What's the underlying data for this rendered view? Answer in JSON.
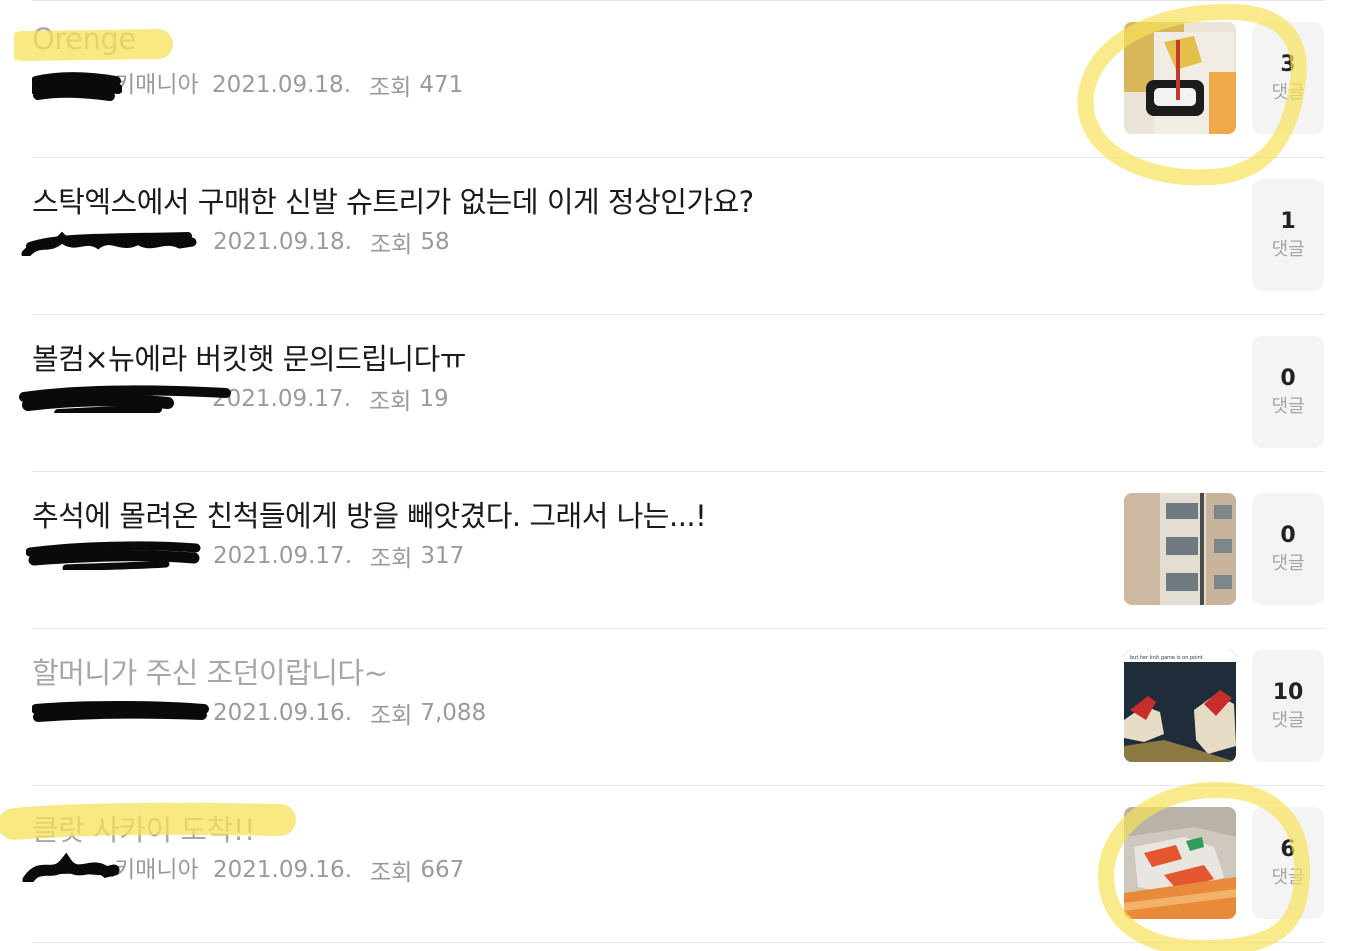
{
  "comment_label": "댓글",
  "views_label": "조회",
  "posts": [
    {
      "title": "Orenge",
      "author": "키매니아",
      "date": "2021.09.18.",
      "views": "471",
      "comments": "3",
      "read": true
    },
    {
      "title": "스탁엑스에서 구매한 신발 슈트리가 없는데 이게 정상인가요?",
      "author": "",
      "date": "2021.09.18.",
      "views": "58",
      "comments": "1",
      "read": false
    },
    {
      "title": "볼컴×뉴에라 버킷햇 문의드립니다ㅠ",
      "author": "",
      "date": "2021.09.17.",
      "views": "19",
      "comments": "0",
      "read": false
    },
    {
      "title": "추석에 몰려온 친척들에게 방을 빼앗겼다. 그래서 나는...!",
      "author": "",
      "date": "2021.09.17.",
      "views": "317",
      "comments": "0",
      "read": false
    },
    {
      "title": "할머니가 주신 조던이랍니다~",
      "author": "",
      "date": "2021.09.16.",
      "views": "7,088",
      "comments": "10",
      "read": true
    },
    {
      "title": "클랏 사카이 도착!!",
      "author": "키매니아",
      "date": "2021.09.16.",
      "views": "667",
      "comments": "6",
      "read": true
    }
  ],
  "thumb_caption": "but her knit game is on point",
  "highlight_color": "#f7e15a"
}
